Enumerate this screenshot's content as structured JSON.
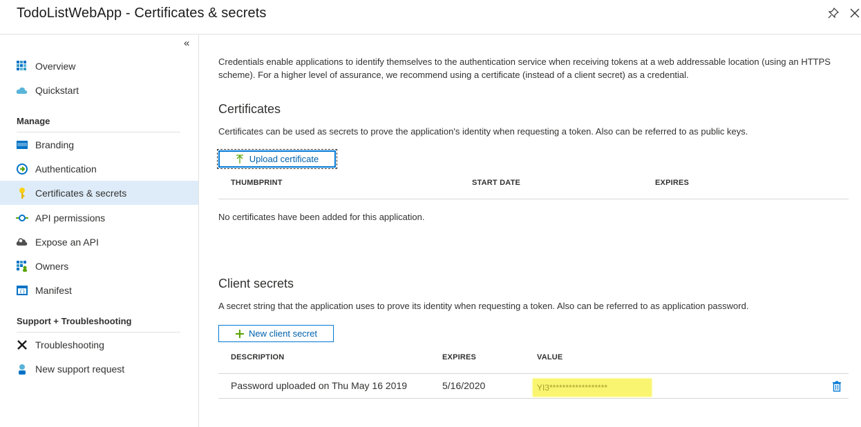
{
  "header": {
    "title": "TodoListWebApp - Certificates & secrets",
    "pin_icon": "pin-icon",
    "close_icon": "close-icon"
  },
  "sidebar": {
    "collapse_glyph": "«",
    "items_top": [
      {
        "label": "Overview",
        "icon": "overview-grid-icon"
      },
      {
        "label": "Quickstart",
        "icon": "cloud-icon"
      }
    ],
    "manage_label": "Manage",
    "items_manage": [
      {
        "label": "Branding",
        "icon": "branding-icon"
      },
      {
        "label": "Authentication",
        "icon": "authentication-icon"
      },
      {
        "label": "Certificates & secrets",
        "icon": "key-icon",
        "active": true
      },
      {
        "label": "API permissions",
        "icon": "api-permissions-icon"
      },
      {
        "label": "Expose an API",
        "icon": "cloud-gear-icon"
      },
      {
        "label": "Owners",
        "icon": "owners-icon"
      },
      {
        "label": "Manifest",
        "icon": "manifest-icon"
      }
    ],
    "support_label": "Support + Troubleshooting",
    "items_support": [
      {
        "label": "Troubleshooting",
        "icon": "wrench-icon"
      },
      {
        "label": "New support request",
        "icon": "support-person-icon"
      }
    ]
  },
  "main": {
    "intro": "Credentials enable applications to identify themselves to the authentication service when receiving tokens at a web addressable location (using an HTTPS scheme). For a higher level of assurance, we recommend using a certificate (instead of a client secret) as a credential.",
    "certificates": {
      "title": "Certificates",
      "description": "Certificates can be used as secrets to prove the application's identity when requesting a token. Also can be referred to as public keys.",
      "upload_button": "Upload certificate",
      "columns": [
        "THUMBPRINT",
        "START DATE",
        "EXPIRES"
      ],
      "empty_message": "No certificates have been added for this application."
    },
    "client_secrets": {
      "title": "Client secrets",
      "description": "A secret string that the application uses to prove its identity when requesting a token. Also can be referred to as application password.",
      "new_button": "New client secret",
      "columns": [
        "DESCRIPTION",
        "EXPIRES",
        "VALUE"
      ],
      "rows": [
        {
          "description": "Password uploaded on Thu May 16 2019",
          "expires": "5/16/2020",
          "value": "YI3******************"
        }
      ]
    }
  },
  "colors": {
    "accent": "#0078d4",
    "active_bg": "#deecf9",
    "highlight": "#f9f571",
    "add_green": "#57a300"
  }
}
